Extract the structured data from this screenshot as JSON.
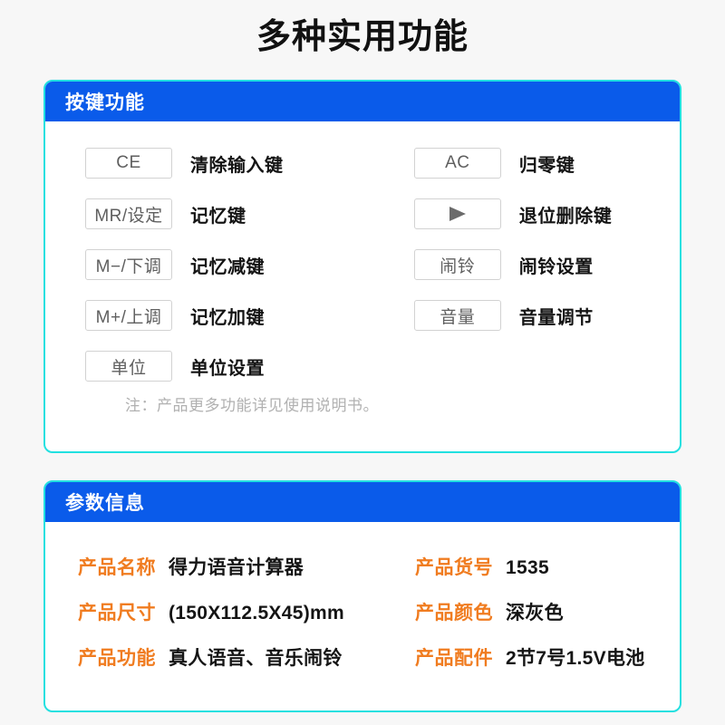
{
  "page": {
    "title": "多种实用功能",
    "background_color": "#f7f7f7",
    "accent_blue": "#0a5bea",
    "accent_cyan": "#22e0e0",
    "accent_orange": "#f07c20"
  },
  "key_functions_card": {
    "header": "按键功能",
    "left_column": [
      {
        "key": "CE",
        "icon": "",
        "desc": "清除输入键"
      },
      {
        "key": "MR/设定",
        "icon": "",
        "desc": "记忆键"
      },
      {
        "key": "M−/下调",
        "icon": "",
        "desc": "记忆减键"
      },
      {
        "key": "M+/上调",
        "icon": "",
        "desc": "记忆加键"
      },
      {
        "key": "单位",
        "icon": "",
        "desc": "单位设置"
      }
    ],
    "right_column": [
      {
        "key": "AC",
        "icon": "",
        "desc": "归零键"
      },
      {
        "key": "",
        "icon": "play-triangle",
        "desc": "退位删除键"
      },
      {
        "key": "闹铃",
        "icon": "",
        "desc": "闹铃设置"
      },
      {
        "key": "音量",
        "icon": "",
        "desc": "音量调节"
      }
    ],
    "note": "注：产品更多功能详见使用说明书。"
  },
  "parameters_card": {
    "header": "参数信息",
    "rows": [
      {
        "left_label": "产品名称",
        "left_value": "得力语音计算器",
        "right_label": "产品货号",
        "right_value": "1535"
      },
      {
        "left_label": "产品尺寸",
        "left_value": "(150X112.5X45)mm",
        "right_label": "产品颜色",
        "right_value": "深灰色"
      },
      {
        "left_label": "产品功能",
        "left_value": "真人语音、音乐闹铃",
        "right_label": "产品配件",
        "right_value": "2节7号1.5V电池"
      }
    ]
  }
}
